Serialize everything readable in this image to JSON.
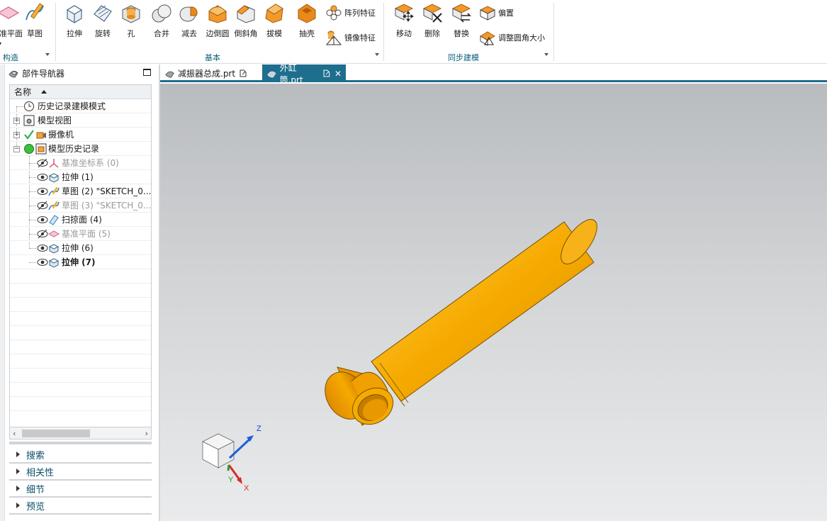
{
  "ribbon": {
    "group_construct": {
      "title": "构造",
      "items": [
        "基准平面",
        "草图"
      ]
    },
    "group_basic": {
      "title": "基本",
      "items": [
        "拉伸",
        "旋转",
        "孔",
        "合并",
        "减去",
        "边倒圆",
        "倒斜角",
        "拔模",
        "抽壳"
      ],
      "small_items": [
        "阵列特征",
        "镜像特征"
      ]
    },
    "group_sync": {
      "title": "同步建模",
      "items": [
        "移动",
        "删除",
        "替换"
      ],
      "small_items": [
        "偏置",
        "调整圆角大小"
      ]
    }
  },
  "navigator": {
    "title": "部件导航器",
    "column_header": "名称",
    "rows": [
      {
        "label": "历史记录建模模式",
        "icon": "clock-icon"
      },
      {
        "label": "模型视图",
        "icon": "model-view-icon"
      },
      {
        "label": "摄像机",
        "icon": "camera-icon"
      },
      {
        "label": "模型历史记录",
        "icon": "model-history-icon"
      },
      {
        "label": "基准坐标系 (0)",
        "icon": "datum-csys-icon"
      },
      {
        "label": "拉伸 (1)",
        "icon": "extrude-icon"
      },
      {
        "label": "草图 (2) \"SKETCH_0...",
        "icon": "sketch-icon"
      },
      {
        "label": "草图 (3) \"SKETCH_0...",
        "icon": "sketch-icon"
      },
      {
        "label": "扫掠面 (4)",
        "icon": "sweep-face-icon"
      },
      {
        "label": "基准平面 (5)",
        "icon": "datum-plane-icon"
      },
      {
        "label": "拉伸 (6)",
        "icon": "extrude-icon"
      },
      {
        "label": "拉伸 (7)",
        "icon": "extrude-icon"
      }
    ],
    "sections": [
      "搜索",
      "相关性",
      "细节",
      "预览"
    ]
  },
  "tabs": [
    {
      "label": "减振器总成.prt",
      "active": false
    },
    {
      "label": "外缸筒.prt",
      "active": true
    }
  ],
  "triad": {
    "z": "Z",
    "y": "Y",
    "x": "X"
  },
  "colors": {
    "accent": "#1e6e8e",
    "part_orange": "#f2a400",
    "toolbar_orange": "#e8891a"
  }
}
